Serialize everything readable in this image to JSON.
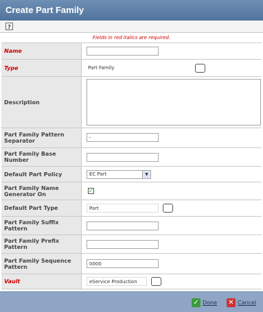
{
  "window": {
    "title": "Create Part Family"
  },
  "toolbar": {
    "help_icon": "help-icon"
  },
  "notice": "Fields in red italics are required.",
  "fields": {
    "name": {
      "label": "Name",
      "value": ""
    },
    "type": {
      "label": "Type",
      "value": "Part Family"
    },
    "description": {
      "label": "Description",
      "value": ""
    },
    "separator": {
      "label": "Part Family Pattern Separator",
      "value": "-"
    },
    "base_number": {
      "label": "Part Family Base Number",
      "value": ""
    },
    "policy": {
      "label": "Default Part Policy",
      "value": "EC Part"
    },
    "name_generator": {
      "label": "Part Family Name Generator On",
      "checked": true
    },
    "part_type": {
      "label": "Default Part Type",
      "value": "Part"
    },
    "suffix": {
      "label": "Part Family Suffix Pattern",
      "value": ""
    },
    "prefix": {
      "label": "Part Family Prefix Pattern",
      "value": ""
    },
    "sequence": {
      "label": "Part Family Sequence Pattern",
      "value": "0000"
    },
    "vault": {
      "label": "Vault",
      "value": "eService Production"
    }
  },
  "footer": {
    "done_label": "Done",
    "cancel_label": "Cancel"
  },
  "colors": {
    "required": "#cc0000",
    "title_bar": "#5a7aa5",
    "footer": "#8fa6c6"
  }
}
